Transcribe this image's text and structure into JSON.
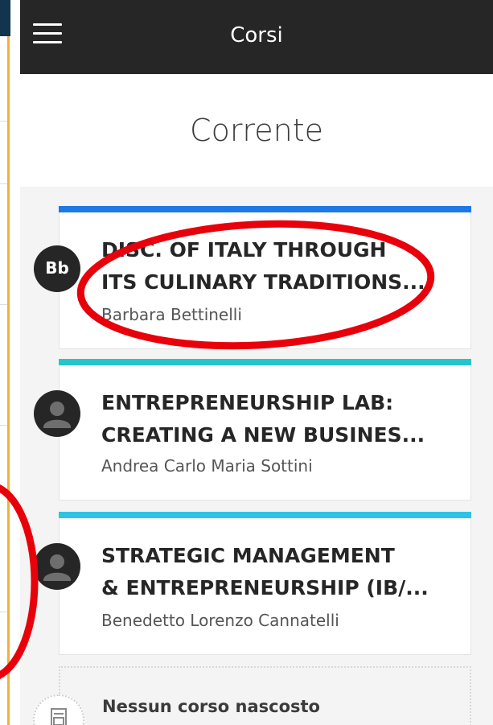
{
  "topbar": {
    "title": "Corsi",
    "menu_icon": "hamburger-icon"
  },
  "section": {
    "title": "Corrente"
  },
  "courses": [
    {
      "title_line1": "DISC. OF ITALY THROUGH",
      "title_line2": "ITS CULINARY TRADITIONS...",
      "instructor": "Barbara Bettinelli",
      "avatar_initials": "Bb",
      "accent_color": "#1e78e6"
    },
    {
      "title_line1": "ENTREPRENEURSHIP LAB:",
      "title_line2": "CREATING A NEW BUSINES...",
      "instructor": "Andrea Carlo Maria Sottini",
      "avatar_icon": "person-icon",
      "accent_color": "#25c6cb"
    },
    {
      "title_line1": "STRATEGIC MANAGEMENT",
      "title_line2": "& ENTREPRENEURSHIP (IB/...",
      "instructor": "Benedetto Lorenzo Cannatelli",
      "avatar_icon": "person-icon",
      "accent_color": "#2ec3e6"
    }
  ],
  "hidden_courses": {
    "text": "Nessun corso nascosto",
    "icon": "document-icon"
  },
  "annotation": {
    "color": "#e8000b"
  }
}
